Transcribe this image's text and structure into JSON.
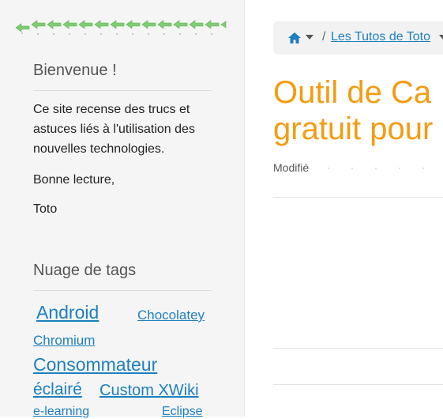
{
  "sidebar": {
    "welcome": {
      "title": "Bienvenue !",
      "paragraph": "Ce site recense des trucs et astuces liés à l'utilisation des nouvelles technologies.",
      "greeting": "Bonne lecture,",
      "signature": "Toto"
    },
    "tag_cloud": {
      "title": "Nuage de tags",
      "tags": [
        {
          "label": "Android"
        },
        {
          "label": "Chocolatey"
        },
        {
          "label": "Chromium"
        },
        {
          "label": "Consommateur"
        },
        {
          "label": "éclairé"
        },
        {
          "label": "Custom XWiki"
        },
        {
          "label": "e-learning"
        },
        {
          "label": "Eclipse"
        }
      ]
    }
  },
  "breadcrumb": {
    "home_icon": "home-icon",
    "separator": "/",
    "item": "Les Tutos de Toto"
  },
  "page": {
    "title_line1": "Outil de Ca",
    "title_line2": "gratuit pour",
    "modified_label": "Modifié"
  },
  "colors": {
    "title": "#f39c12",
    "link": "#1e7fbf",
    "sidebar_bg": "#f5f5f5"
  }
}
